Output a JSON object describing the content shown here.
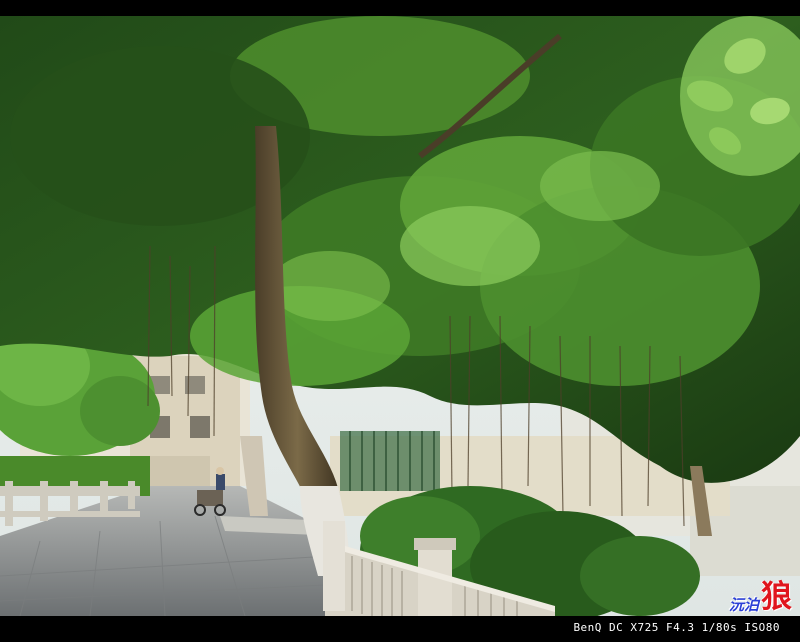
{
  "photo": {
    "subject": "banyan-tree-over-street",
    "colors": {
      "sky": "#e8eef0",
      "canopy_dark": "#1c3a14",
      "canopy_mid": "#3f7a26",
      "canopy_light": "#7fc24a",
      "trunk": "#6a5a3c",
      "road": "#8a8d8e",
      "railing": "#d9d4c8"
    }
  },
  "watermark": {
    "text": "沅泊",
    "logo_char": "狼"
  },
  "exif_caption": "BenQ DC X725 F4.3 1/80s ISO80"
}
